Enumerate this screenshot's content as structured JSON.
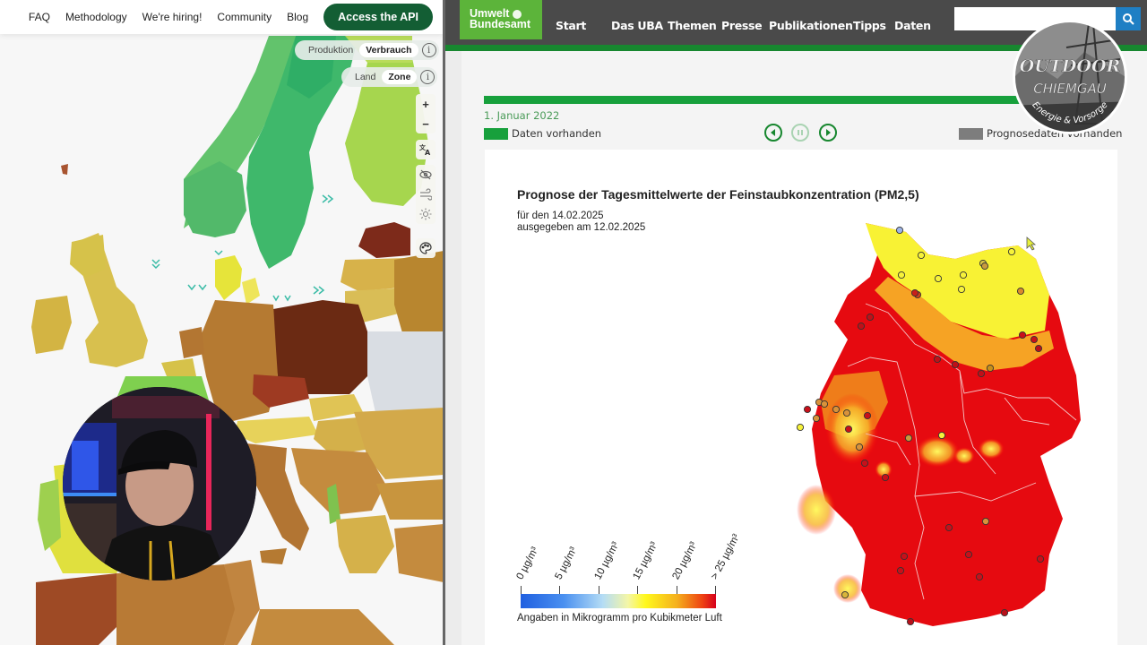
{
  "left_panel": {
    "nav": {
      "links": [
        "FAQ",
        "Methodology",
        "We're hiring!",
        "Community",
        "Blog"
      ],
      "cta_label": "Access the API",
      "cta_color": "#135e34"
    },
    "mode_toggle": {
      "options": [
        "Produktion",
        "Verbrauch"
      ],
      "selected": "Verbrauch",
      "info_label": "i"
    },
    "area_toggle": {
      "options": [
        "Land",
        "Zone"
      ],
      "selected": "Zone",
      "info_label": "i"
    },
    "map_controls": [
      {
        "name": "zoom-in",
        "glyph": "+"
      },
      {
        "name": "zoom-out",
        "glyph": "−"
      },
      {
        "name": "language",
        "glyph": "文A"
      },
      {
        "name": "visibility",
        "glyph": "◎"
      },
      {
        "name": "wind",
        "glyph": "≋"
      },
      {
        "name": "solar",
        "glyph": "☼"
      },
      {
        "name": "palette",
        "glyph": "🎨"
      }
    ],
    "webcam_overlay": "presenter-webcam"
  },
  "right_panel": {
    "header": {
      "logo_line1": "Umwelt",
      "logo_line2": "Bundesamt",
      "nav": [
        "Start",
        "Das UBA",
        "Themen",
        "Presse",
        "Publikationen",
        "Tipps",
        "Daten"
      ],
      "search_placeholder": "",
      "search_icon": "search-icon"
    },
    "timeline": {
      "date": "1. Januar 2022",
      "legend_available": "Daten vorhanden",
      "legend_forecast": "Prognosedaten vorhanden",
      "controls": [
        "previous",
        "pause",
        "next"
      ],
      "progress_fraction": 1.0
    },
    "chart": {
      "title": "Prognose der Tagesmittelwerte der Feinstaubkonzentration (PM2,5)",
      "for_date": "für den 14.02.2025",
      "issued": "ausgegeben am 12.02.2025",
      "scale_labels": [
        "0 µg/m³",
        "5 µg/m³",
        "10 µg/m³",
        "15 µg/m³",
        "20 µg/m³",
        "> 25 µg/m³"
      ],
      "scale_caption": "Angaben in Mikrogramm pro Kubikmeter Luft",
      "scale_colors": [
        "#1f5fe0",
        "#4a90f0",
        "#b4dcf5",
        "#fff81c",
        "#f5b01d",
        "#d6001c"
      ]
    }
  },
  "overlay_badge": {
    "line1": "OUTDOOR",
    "line2": "CHIEMGAU",
    "line3": "Energie & Vorsorge"
  }
}
